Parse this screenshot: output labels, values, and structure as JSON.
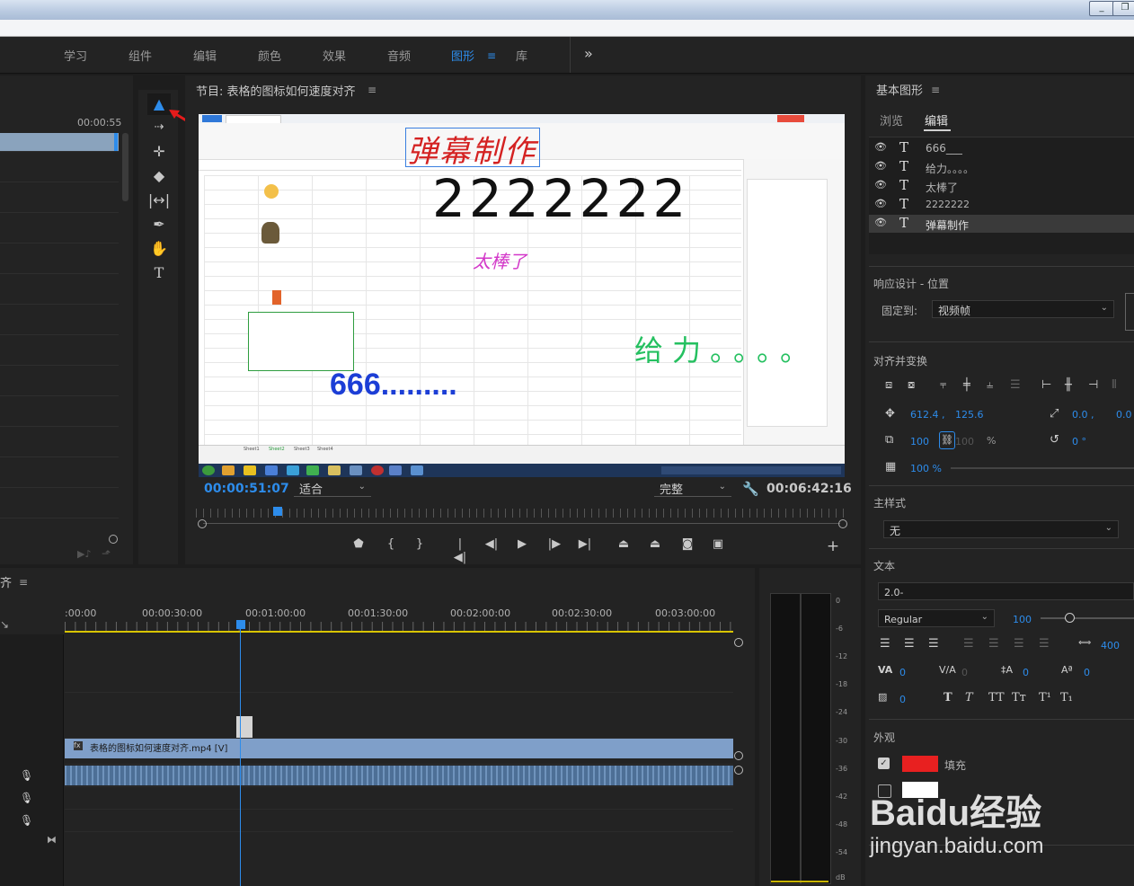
{
  "workspace": {
    "tabs": [
      "学习",
      "组件",
      "编辑",
      "颜色",
      "效果",
      "音频",
      "图形",
      "库"
    ],
    "active": "图形",
    "overflow": "»"
  },
  "source": {
    "timecode": "00:00:55"
  },
  "program": {
    "title": "节目: 表格的图标如何速度对齐",
    "current_time": "00:00:51:07",
    "fit": "适合",
    "quality": "完整",
    "duration": "00:06:42:16"
  },
  "video": {
    "text_title": "弹幕制作",
    "text_number": "2222222",
    "text_great": "太棒了",
    "text_power": "给力。。。。",
    "text_666": "666.........",
    "sheet_tabs": [
      "Sheet1",
      "Sheet2",
      "Sheet3",
      "Sheet4"
    ]
  },
  "essential_graphics": {
    "title": "基本图形",
    "tabs": [
      "浏览",
      "编辑"
    ],
    "active_tab": "编辑",
    "layers": [
      "666___",
      "给力。。。。",
      "太棒了",
      "2222222",
      "弹幕制作"
    ],
    "selected_layer": "弹幕制作",
    "responsive_title": "响应设计 - 位置",
    "pin_label": "固定到:",
    "pin_value": "视频帧",
    "align_title": "对齐并变换",
    "pos_x": "612.4 ,",
    "pos_y": "125.6",
    "anchor_x": "0.0 ,",
    "anchor_y": "0.0",
    "scale": "100",
    "scale_w": "100",
    "scale_unit": "%",
    "rotation": "0 °",
    "opacity": "100 %",
    "master_style_title": "主样式",
    "master_style_value": "无",
    "text_title": "文本",
    "font": "2.0-",
    "font_style": "Regular",
    "font_size": "100",
    "tracking": "400",
    "kerning": "0",
    "tracking2": "0",
    "leading": "0",
    "baseline": "0",
    "tsume": "0",
    "appearance_title": "外观",
    "fill_label": "填充",
    "fill_color": "#e82020",
    "stroke_color": "#ffffff"
  },
  "timeline": {
    "title": "齐",
    "ruler": [
      ":00:00",
      "00:00:30:00",
      "00:01:00:00",
      "00:01:30:00",
      "00:02:00:00",
      "00:02:30:00",
      "00:03:00:00"
    ],
    "clip_label": "表格的图标如何速度对齐.mp4 [V]"
  },
  "meter": {
    "ticks": [
      "0",
      "-6",
      "-12",
      "-18",
      "-24",
      "-30",
      "-36",
      "-42",
      "-48",
      "-54",
      "dB"
    ]
  },
  "watermark": {
    "brand": "Baidu经验",
    "url": "jingyan.baidu.com"
  }
}
